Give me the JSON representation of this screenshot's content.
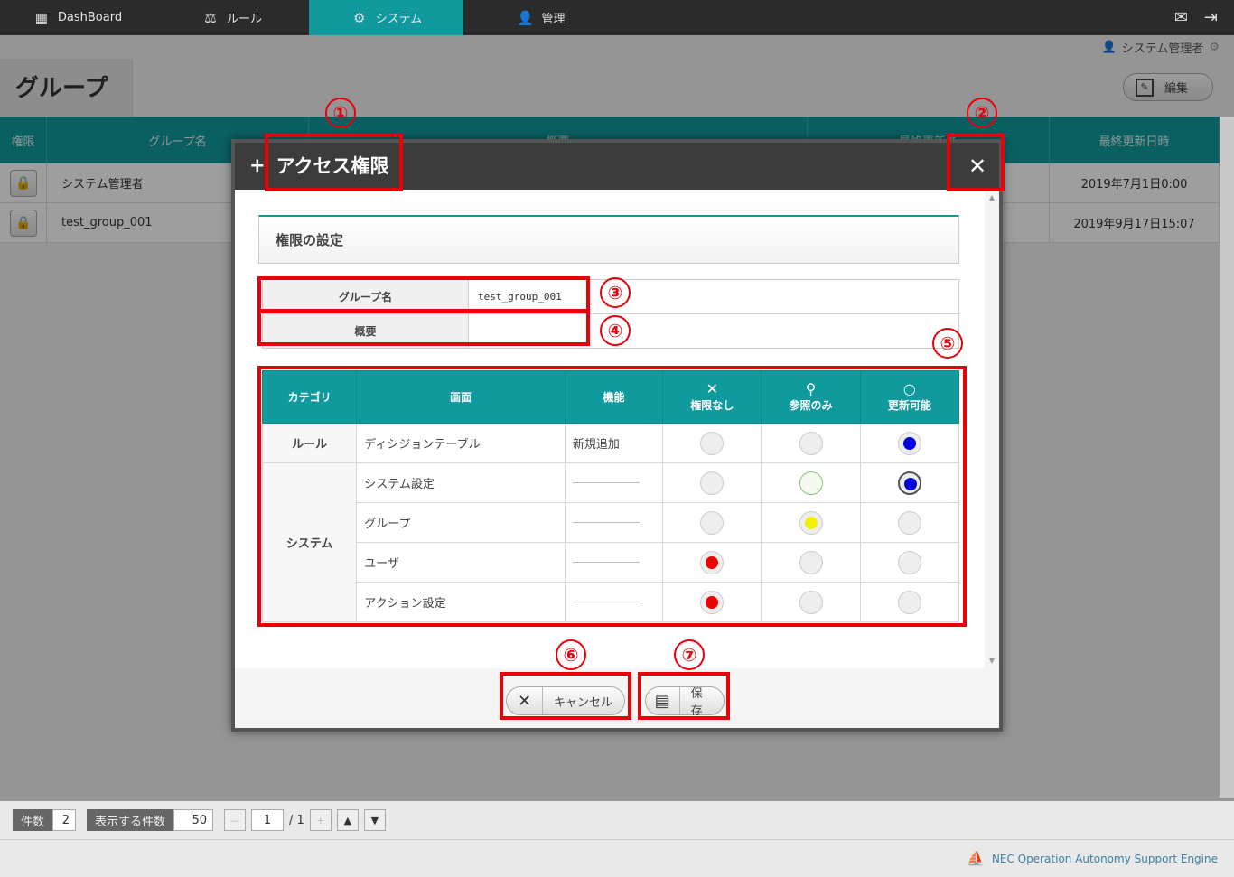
{
  "nav": {
    "items": [
      {
        "label": "DashBoard",
        "icon": "dashboard-icon",
        "active": false
      },
      {
        "label": "ルール",
        "icon": "scale-icon",
        "active": false
      },
      {
        "label": "システム",
        "icon": "gears-icon",
        "active": true
      },
      {
        "label": "管理",
        "icon": "admin-icon",
        "active": false
      }
    ]
  },
  "user": {
    "name": "システム管理者"
  },
  "page": {
    "title": "グループ",
    "edit_label": "編集"
  },
  "list": {
    "columns": [
      "権限",
      "グループ名",
      "概要",
      "最終更新者",
      "最終更新日時"
    ],
    "rows": [
      {
        "name": "システム管理者",
        "updated": "2019年7月1日0:00"
      },
      {
        "name": "test_group_001",
        "updated": "2019年9月17日15:07"
      }
    ]
  },
  "pager": {
    "count_label": "件数",
    "count": "2",
    "per_page_label": "表示する件数",
    "per_page": "50",
    "page": "1",
    "total": "/ 1"
  },
  "footer": {
    "brand": "NEC Operation Autonomy Support Engine"
  },
  "dialog": {
    "title": "アクセス権限",
    "section_title": "権限の設定",
    "group_name_label": "グループ名",
    "group_name_value": "test_group_001",
    "summary_label": "概要",
    "summary_value": "",
    "headers": {
      "category": "カテゴリ",
      "screen": "画面",
      "function": "機能",
      "none": "権限なし",
      "view": "参照のみ",
      "edit": "更新可能"
    },
    "rows": [
      {
        "category": "ルール",
        "screen": "ディシジョンテーブル",
        "function": "新規追加",
        "selected": "edit"
      },
      {
        "category": "システム",
        "screen": "システム設定",
        "function": "",
        "selected": "edit"
      },
      {
        "category": "",
        "screen": "グループ",
        "function": "",
        "selected": "view"
      },
      {
        "category": "",
        "screen": "ユーザ",
        "function": "",
        "selected": "none"
      },
      {
        "category": "",
        "screen": "アクション設定",
        "function": "",
        "selected": "none"
      }
    ],
    "cancel_label": "キャンセル",
    "save_label": "保存"
  },
  "annotations": [
    "①",
    "②",
    "③",
    "④",
    "⑤",
    "⑥",
    "⑦"
  ],
  "colors": {
    "accent": "#119a9d",
    "annotation": "#e8000b",
    "edit_dot": "#0000e0",
    "view_dot": "#f0f000",
    "none_dot": "#f00000"
  }
}
